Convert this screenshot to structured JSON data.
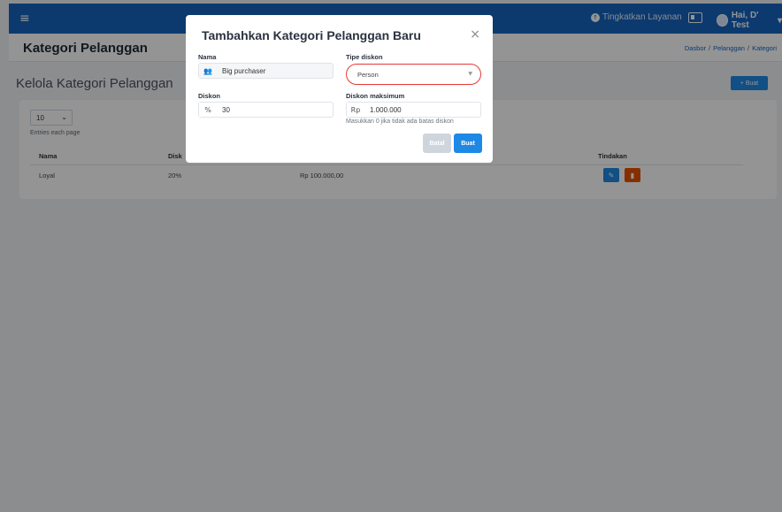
{
  "topbar": {
    "menu_icon": "hamburger-icon",
    "upgrade_label": "Tingkatkan Layanan",
    "user_label": "Hai, D' Test",
    "user_caret": "▾"
  },
  "header": {
    "title": "Kategori Pelanggan",
    "breadcrumb": [
      "Dasbor",
      "Pelanggan",
      "Kategori"
    ]
  },
  "content": {
    "title": "Kelola Kategori Pelanggan",
    "create_label": "+ Buat",
    "entries_value": "10",
    "entries_label": "Entries each page",
    "columns": [
      "Nama",
      "Disk",
      "",
      "Tindakan"
    ],
    "rows": [
      {
        "name": "Loyal",
        "discount": "20%",
        "max": "Rp 100.000,00"
      }
    ]
  },
  "modal": {
    "title": "Tambahkan Kategori Pelanggan Baru",
    "close": "×",
    "name_label": "Nama",
    "name_value": "Big purchaser",
    "type_label": "Tipe diskon",
    "type_value": "Person",
    "discount_label": "Diskon",
    "discount_prefix": "%",
    "discount_value": "30",
    "max_label": "Diskon maksimum",
    "max_prefix": "Rp",
    "max_value": "1.000.000",
    "hint": "Masukkan 0 jika tidak ada batas diskon",
    "cancel_label": "Batal",
    "create_label": "Buat"
  },
  "colors": {
    "primary": "#1565c0",
    "accent": "#1e88e5",
    "danger": "#e65100",
    "error_border": "#e53935"
  }
}
